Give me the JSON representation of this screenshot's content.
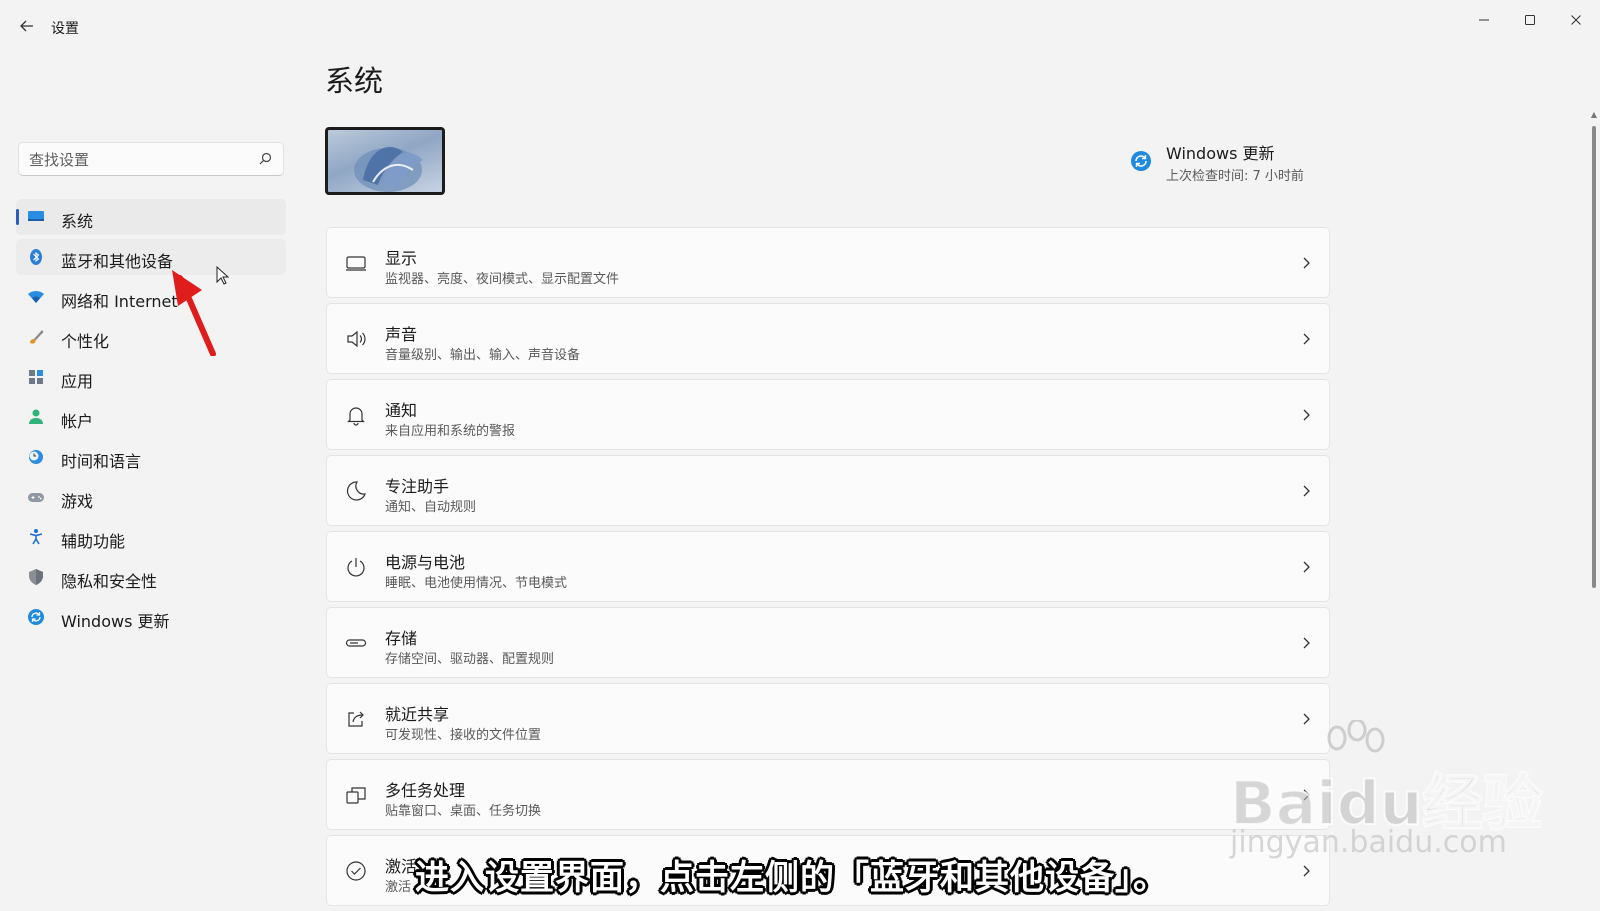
{
  "app": {
    "title": "设置"
  },
  "search": {
    "placeholder": "查找设置"
  },
  "sidebar": {
    "items": [
      {
        "label": "系统",
        "icon": "monitor-icon"
      },
      {
        "label": "蓝牙和其他设备",
        "icon": "bluetooth-icon"
      },
      {
        "label": "网络和 Internet",
        "icon": "wifi-icon"
      },
      {
        "label": "个性化",
        "icon": "brush-icon"
      },
      {
        "label": "应用",
        "icon": "apps-icon"
      },
      {
        "label": "帐户",
        "icon": "person-icon"
      },
      {
        "label": "时间和语言",
        "icon": "clock-globe-icon"
      },
      {
        "label": "游戏",
        "icon": "gamepad-icon"
      },
      {
        "label": "辅助功能",
        "icon": "accessibility-icon"
      },
      {
        "label": "隐私和安全性",
        "icon": "shield-icon"
      },
      {
        "label": "Windows 更新",
        "icon": "update-icon"
      }
    ]
  },
  "main": {
    "title": "系统",
    "update": {
      "title": "Windows 更新",
      "subtitle": "上次检查时间: 7 小时前"
    },
    "cards": [
      {
        "title": "显示",
        "subtitle": "监视器、亮度、夜间模式、显示配置文件",
        "icon": "display-icon"
      },
      {
        "title": "声音",
        "subtitle": "音量级别、输出、输入、声音设备",
        "icon": "speaker-icon"
      },
      {
        "title": "通知",
        "subtitle": "来自应用和系统的警报",
        "icon": "bell-icon"
      },
      {
        "title": "专注助手",
        "subtitle": "通知、自动规则",
        "icon": "moon-icon"
      },
      {
        "title": "电源与电池",
        "subtitle": "睡眠、电池使用情况、节电模式",
        "icon": "power-icon"
      },
      {
        "title": "存储",
        "subtitle": "存储空间、驱动器、配置规则",
        "icon": "storage-icon"
      },
      {
        "title": "就近共享",
        "subtitle": "可发现性、接收的文件位置",
        "icon": "share-icon"
      },
      {
        "title": "多任务处理",
        "subtitle": "贴靠窗口、桌面、任务切换",
        "icon": "multitask-icon"
      },
      {
        "title": "激活",
        "subtitle": "激活",
        "icon": "check-circle-icon"
      }
    ]
  },
  "overlay": {
    "caption": "进入设置界面，点击左侧的「蓝牙和其他设备」。",
    "watermark_brand": "Baidu经验",
    "watermark_url": "jingyan.baidu.com"
  },
  "colors": {
    "accent": "#2b5fb8",
    "annotation": "#e01d1d"
  }
}
